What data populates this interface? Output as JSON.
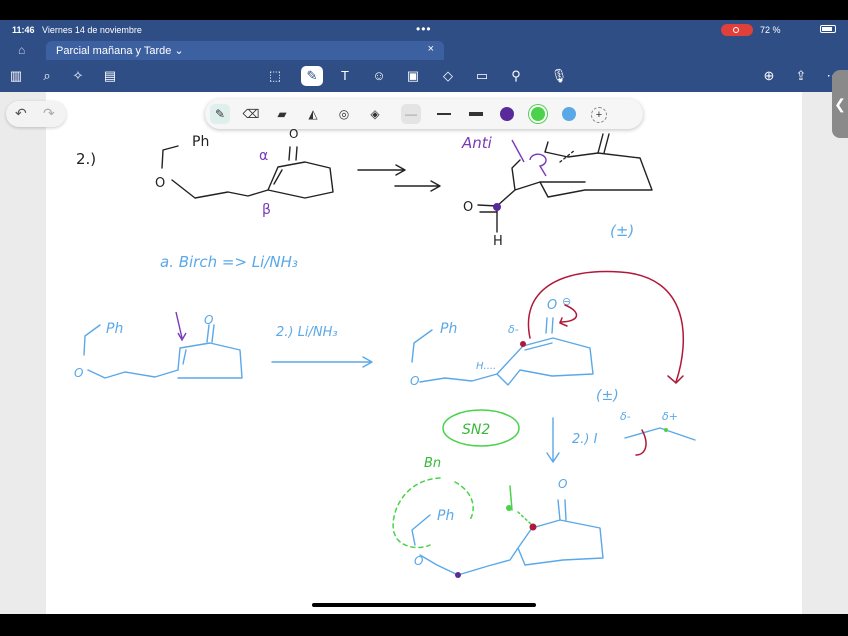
{
  "status": {
    "time": "11:46",
    "date": "Viernes 14 de noviembre",
    "dots": "•••",
    "battery": "72 %"
  },
  "tab": {
    "title": "Parcial mañana y Tarde ⌄",
    "close": "×"
  },
  "icons": {
    "home": "⌂",
    "sidebar": "▥",
    "search": "⌕",
    "sparkle": "✧",
    "pages": "▤",
    "lasso": "⬚",
    "pen": "✎",
    "textbox": "T",
    "sticker": "☺",
    "image": "▣",
    "shapes": "◇",
    "comment": "▭",
    "wand": "⚲",
    "mic": "🎙",
    "add-page": "⊕",
    "share": "⇪",
    "more": "⋯",
    "undo": "↶",
    "redo": "↷",
    "fountain-pen": "✎",
    "eraser": "⌫",
    "highlighter": "▰",
    "marker": "◭",
    "lasso-tool": "◎",
    "shapes-tool": "◈",
    "add-color": "+",
    "collapse": "❮"
  },
  "palette": {
    "colors": [
      "#5a2a9a",
      "#4ad24a",
      "#5ba8e8"
    ],
    "thin": "—"
  },
  "ink": {
    "step_num": "2.)",
    "ph1": "Ph",
    "o1": "O",
    "alpha": "α",
    "beta": "β",
    "o_top1": "O",
    "anti": "Anti",
    "o_ald": "O",
    "h_ald": "H",
    "racemic1": "(±)",
    "condition1": "a. Birch => Li/NH₃",
    "ph2": "Ph",
    "o2": "O",
    "ketone_o2": "O",
    "step2": "2.) Li/NH₃",
    "ph3": "Ph",
    "o3": "O",
    "h_label": "H....",
    "enolate_o": "O",
    "enolate_minus": "⊖",
    "charge_minus": "δ-",
    "racemic2": "(±)",
    "sn2": "SN2",
    "step2b": "2.) I",
    "delta_minus": "δ-",
    "delta_plus": "δ+",
    "bn": "Bn",
    "ph4": "Ph",
    "o4": "O",
    "ketone_o4": "O"
  }
}
